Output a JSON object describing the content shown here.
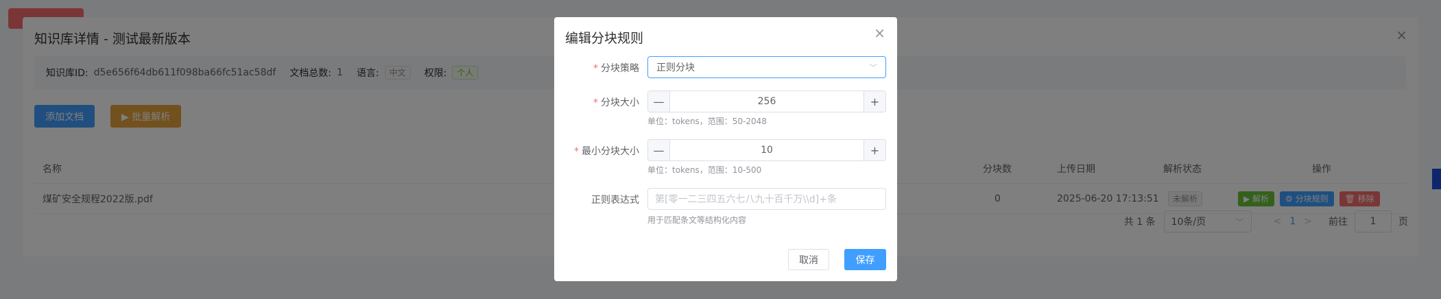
{
  "kb_dialog": {
    "title": "知识库详情 - 测试最新版本",
    "close_icon": "×",
    "info": {
      "id_label": "知识库ID:",
      "id_value": "d5e656f64db611f098ba66fc51ac58df",
      "doc_count_label": "文档总数:",
      "doc_count_value": "1",
      "language_label": "语言:",
      "language_value": "中文",
      "permission_label": "权限:",
      "permission_value": "个人"
    },
    "add_doc_button": "添加文档",
    "batch_parse_button": "▶ 批量解析",
    "table": {
      "headers": {
        "name": "名称",
        "chunks": "分块数",
        "upload_date": "上传日期",
        "parse_status": "解析状态",
        "actions": "操作"
      },
      "rows": [
        {
          "name": "煤矿安全规程2022版.pdf",
          "chunks": "0",
          "upload_date": "2025-06-20 17:13:51",
          "parse_status": "未解析",
          "parse_btn": "▶ 解析",
          "rule_btn": "⚙ 分块规则",
          "remove_btn": "🗑 移除"
        }
      ]
    },
    "pager": {
      "total": "共 1 条",
      "page_size": "10条/页",
      "prev": "<",
      "page": "1",
      "next": ">",
      "goto_label": "前往",
      "goto_value": "1",
      "page_unit": "页"
    }
  },
  "modal": {
    "title": "编辑分块规则",
    "close_icon": "×",
    "strategy": {
      "required_mark": "*",
      "label": "分块策略",
      "value": "正则分块",
      "chevron": "﹀"
    },
    "chunk_size": {
      "required_mark": "*",
      "label": "分块大小",
      "minus": "—",
      "value": "256",
      "plus": "+",
      "hint": "单位：tokens，范围：50-2048"
    },
    "min_chunk_size": {
      "required_mark": "*",
      "label": "最小分块大小",
      "minus": "—",
      "value": "10",
      "plus": "+",
      "hint": "单位：tokens，范围：10-500"
    },
    "regex": {
      "label": "正则表达式",
      "placeholder": "第[零一二三四五六七八九十百千万\\\\d]+条",
      "hint": "用于匹配条文等结构化内容"
    },
    "cancel_button": "取消",
    "save_button": "保存"
  },
  "colors": {
    "primary": "#409eff",
    "danger": "#f56c6c",
    "success": "#67c23a",
    "warning": "#e6a23c"
  }
}
